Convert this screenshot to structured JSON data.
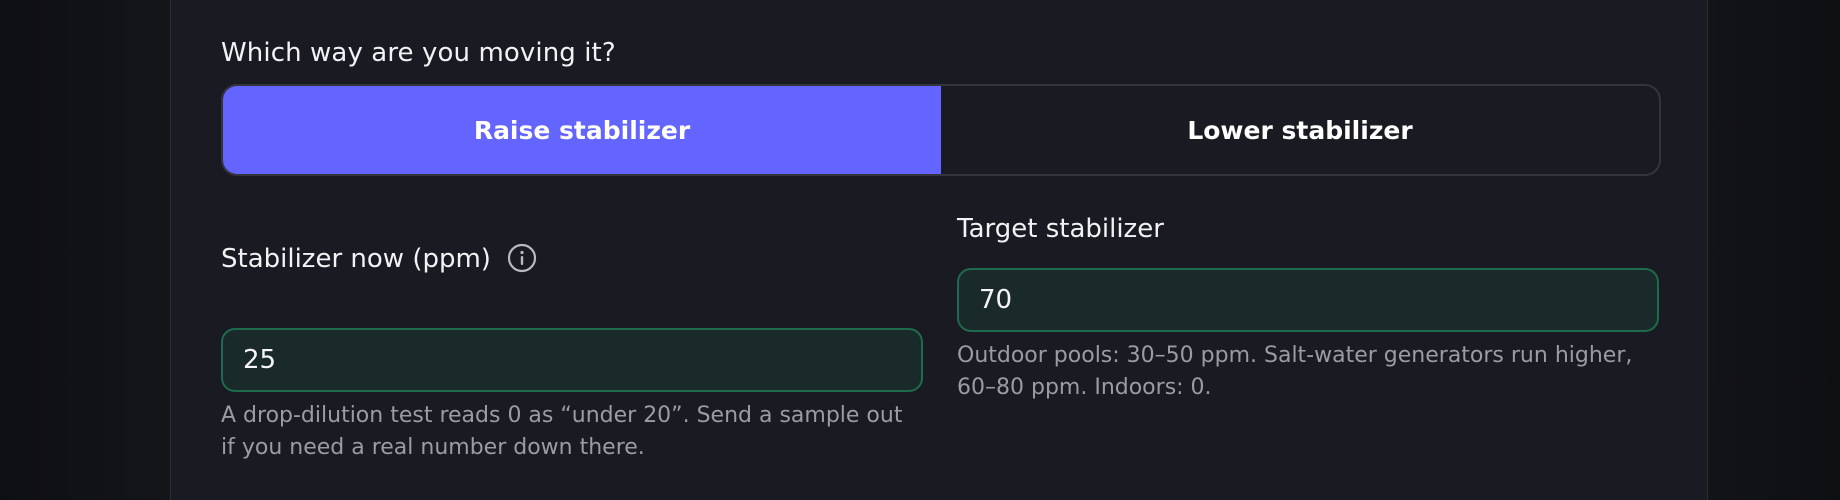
{
  "direction": {
    "question": "Which way are you moving it?",
    "options": [
      "Raise stabilizer",
      "Lower stabilizer"
    ],
    "selected": "Raise stabilizer"
  },
  "current": {
    "label": "Stabilizer now (ppm)",
    "value": "25",
    "help": "A drop-dilution test reads 0 as “under 20”. Send a sample out if you need a real number down there."
  },
  "target": {
    "label": "Target stabilizer",
    "value": "70",
    "help": "Outdoor pools: 30–50 ppm. Salt-water generators run higher, 60–80 ppm. Indoors: 0."
  },
  "colors": {
    "accent": "#6465ff",
    "input_border": "#1e6a4c",
    "input_bg": "#1a2a2b",
    "card_bg": "#1a1b22"
  },
  "icons": {
    "current_info": "info-circle-icon"
  }
}
